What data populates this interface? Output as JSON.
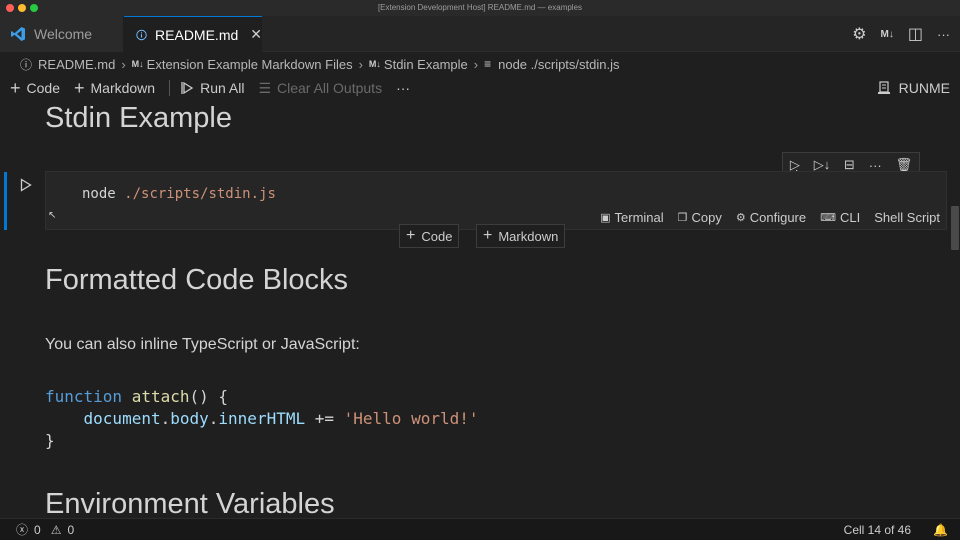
{
  "window": {
    "title": "[Extension Development Host] README.md — examples"
  },
  "tabs": [
    {
      "label": "Welcome",
      "icon": "vscode-logo-icon",
      "active": false
    },
    {
      "label": "README.md",
      "icon": "info-icon",
      "active": true,
      "close": "✕"
    }
  ],
  "tab_actions": {
    "settings": "⚙",
    "markdown": "M↓",
    "split": "◫",
    "more": "···"
  },
  "breadcrumb": [
    "README.md",
    "Extension Example Markdown Files",
    "Stdin Example",
    "node ./scripts/stdin.js"
  ],
  "breadcrumb_icons": {
    "md": "M↓",
    "info": "ⓘ",
    "lines": "≡"
  },
  "toolbar": {
    "code": "Code",
    "markdown": "Markdown",
    "run_all": "Run All",
    "clear_outputs": "Clear All Outputs",
    "more": "···",
    "runme": "RUNME"
  },
  "content": {
    "heading_stdin": "Stdin Example",
    "cell_command": "node",
    "cell_path": "./scripts/stdin.js",
    "cell_actions": {
      "terminal": "Terminal",
      "copy": "Copy",
      "configure": "Configure",
      "cli": "CLI",
      "shell": "Shell Script"
    },
    "insert_code": "Code",
    "insert_markdown": "Markdown",
    "heading_formatted": "Formatted Code Blocks",
    "para_inline": "You can also inline TypeScript or JavaScript:",
    "code": {
      "kw": "function",
      "fn": "attach",
      "line1_rest": "() {",
      "obj": "document",
      "prop1": "body",
      "prop2": "innerHTML",
      "op": " += ",
      "str": "'Hello world!'",
      "close": "}"
    },
    "heading_env": "Environment Variables"
  },
  "statusbar": {
    "errors": "0",
    "warnings": "0",
    "cell_position": "Cell 14 of 46"
  }
}
